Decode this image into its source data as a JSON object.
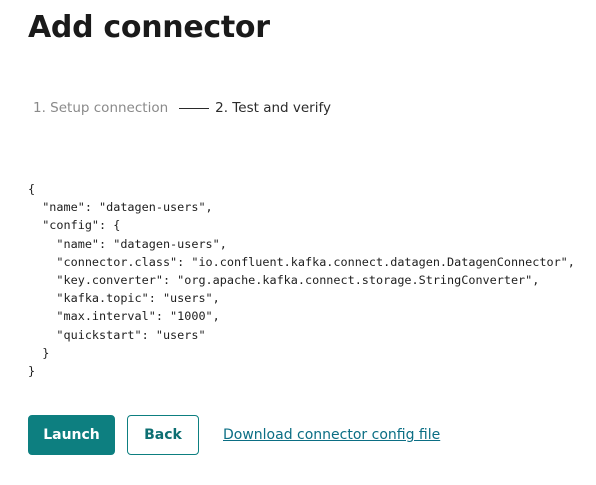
{
  "page": {
    "title": "Add connector"
  },
  "stepper": {
    "steps": [
      {
        "label": "1. Setup connection",
        "state": "completed"
      },
      {
        "label": "2. Test and verify",
        "state": "active"
      }
    ]
  },
  "config_preview": {
    "text": "{\n  \"name\": \"datagen-users\",\n  \"config\": {\n    \"name\": \"datagen-users\",\n    \"connector.class\": \"io.confluent.kafka.connect.datagen.DatagenConnector\",\n    \"key.converter\": \"org.apache.kafka.connect.storage.StringConverter\",\n    \"kafka.topic\": \"users\",\n    \"max.interval\": \"1000\",\n    \"quickstart\": \"users\"\n  }\n}"
  },
  "actions": {
    "launch_label": "Launch",
    "back_label": "Back",
    "download_label": "Download connector config file"
  },
  "colors": {
    "primary": "#0d7f80",
    "link": "#0b6e84",
    "inactive_step": "#8a8a8a"
  }
}
